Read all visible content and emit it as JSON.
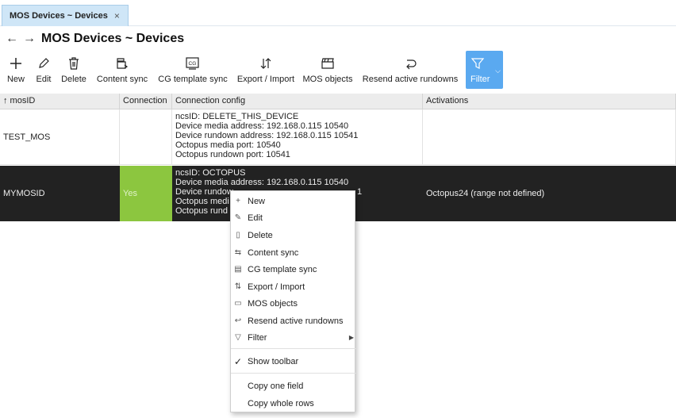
{
  "tab": {
    "label": "MOS Devices ~ Devices",
    "close": "×"
  },
  "titlebar": {
    "back": "←",
    "forward": "→",
    "title": "MOS Devices  ~ Devices"
  },
  "toolbar": {
    "new": "New",
    "edit": "Edit",
    "delete": "Delete",
    "content_sync": "Content sync",
    "cg_template_sync": "CG template sync",
    "export_import": "Export / Import",
    "mos_objects": "MOS objects",
    "resend": "Resend active rundowns",
    "filter": "Filter"
  },
  "table": {
    "headers": [
      "↑ mosID",
      "Connection",
      "Connection config",
      "Activations"
    ],
    "rows": [
      {
        "mosid": "TEST_MOS",
        "connection": "",
        "config": [
          "ncsID: DELETE_THIS_DEVICE",
          "Device media address: 192.168.0.115 10540",
          "Device rundown address: 192.168.0.115 10541",
          "Octopus media port: 10540",
          "Octopus rundown port: 10541"
        ],
        "activations": ""
      },
      {
        "mosid": "MYMOSID",
        "connection": "Yes",
        "config": [
          "ncsID: OCTOPUS",
          "Device media address: 192.168.0.115 10540",
          "Device rundow",
          "Octopus medi",
          "Octopus rund"
        ],
        "config_tail": "1",
        "activations": "Octopus24 (range not defined)"
      }
    ]
  },
  "context_menu": {
    "items": [
      "New",
      "Edit",
      "Delete",
      "Content sync",
      "CG template sync",
      "Export / Import",
      "MOS objects",
      "Resend active rundowns",
      "Filter"
    ],
    "show_toolbar": "Show toolbar",
    "show_toolbar_check": "✓",
    "copy_one_field": "Copy one field",
    "copy_whole_rows": "Copy whole rows"
  },
  "colors": {
    "accent": "#5aa9f0",
    "selected_row": "#222222",
    "connected": "#8cc63f",
    "tab": "#cfe6f7"
  }
}
